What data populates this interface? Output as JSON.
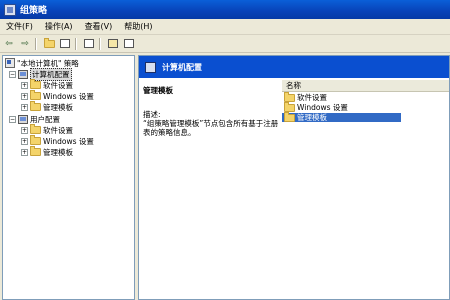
{
  "window": {
    "title": "组策略"
  },
  "menu": [
    "文件(F)",
    "操作(A)",
    "查看(V)",
    "帮助(H)"
  ],
  "toolbar": {
    "icons": [
      "back-arrow-icon",
      "forward-arrow-icon",
      "up-folder-icon",
      "show-hide-tree-icon",
      "export-list-icon",
      "properties-icon",
      "help-icon"
    ]
  },
  "tree": {
    "root": "\"本地计算机\" 策略",
    "nodes": [
      {
        "label": "计算机配置",
        "expander": "−",
        "children": [
          "软件设置",
          "Windows 设置",
          "管理模板"
        ]
      },
      {
        "label": "用户配置",
        "expander": "−",
        "children": [
          "软件设置",
          "Windows 设置",
          "管理模板"
        ]
      }
    ]
  },
  "right_header": {
    "title": "计算机配置"
  },
  "description": {
    "title": "管理模板",
    "label": "描述:",
    "body": "“组策略管理模板”节点包含所有基于注册表的策略信息。"
  },
  "list": {
    "column": "名称",
    "items": [
      "软件设置",
      "Windows 设置",
      "管理模板"
    ],
    "selected_index": 2
  },
  "colors": {
    "accent": "#0a4fd0",
    "selection": "#316ac5",
    "folder": "#f4d46a"
  }
}
